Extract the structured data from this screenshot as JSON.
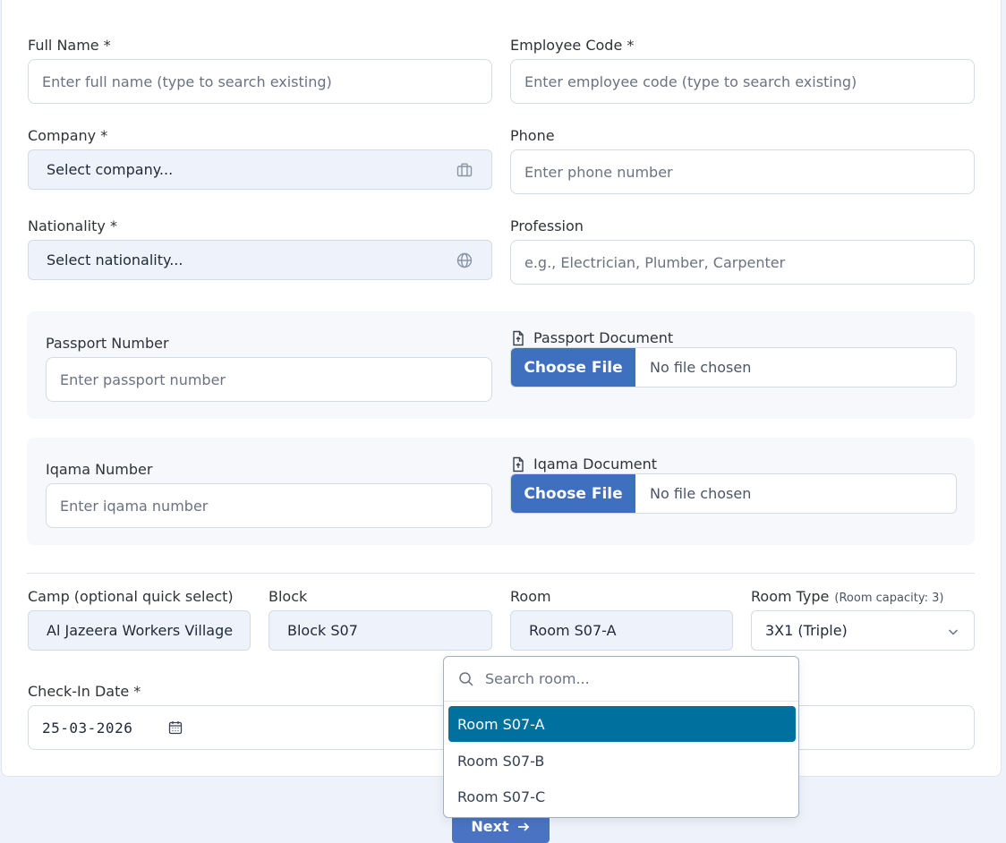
{
  "form": {
    "full_name": {
      "label": "Full Name *",
      "placeholder": "Enter full name (type to search existing)"
    },
    "employee_code": {
      "label": "Employee Code *",
      "placeholder": "Enter employee code (type to search existing)"
    },
    "company": {
      "label": "Company *",
      "value": "Select company...",
      "icon": "briefcase-icon"
    },
    "phone": {
      "label": "Phone",
      "placeholder": "Enter phone number"
    },
    "nationality": {
      "label": "Nationality *",
      "value": "Select nationality...",
      "icon": "globe-icon"
    },
    "profession": {
      "label": "Profession",
      "placeholder": "e.g., Electrician, Plumber, Carpenter"
    },
    "passport_number": {
      "label": "Passport Number",
      "placeholder": "Enter passport number"
    },
    "passport_document": {
      "label": "Passport Document",
      "button": "Choose File",
      "status": "No file chosen",
      "icon": "file-upload-icon"
    },
    "iqama_number": {
      "label": "Iqama Number",
      "placeholder": "Enter iqama number"
    },
    "iqama_document": {
      "label": "Iqama Document",
      "button": "Choose File",
      "status": "No file chosen",
      "icon": "file-upload-icon"
    },
    "camp": {
      "label": "Camp (optional quick select)",
      "value": "Al Jazeera Workers Village"
    },
    "block": {
      "label": "Block",
      "value": "Block S07"
    },
    "room": {
      "label": "Room",
      "value": "Room S07-A"
    },
    "room_type": {
      "label": "Room Type",
      "note": "(Room capacity: 3)",
      "value": "3X1 (Triple)"
    },
    "check_in_date": {
      "label": "Check-In Date *",
      "value": "25-03-2026",
      "icon": "calendar-icon"
    }
  },
  "room_dropdown": {
    "search_placeholder": "Search room...",
    "options": [
      "Room S07-A",
      "Room S07-B",
      "Room S07-C"
    ],
    "selected": "Room S07-A"
  },
  "next_button": {
    "label": "Next",
    "icon": "arrow-right-icon"
  },
  "colors": {
    "accent": "#3f6fbf",
    "selected_option": "#00709f",
    "page_bg": "#eef3fb"
  }
}
